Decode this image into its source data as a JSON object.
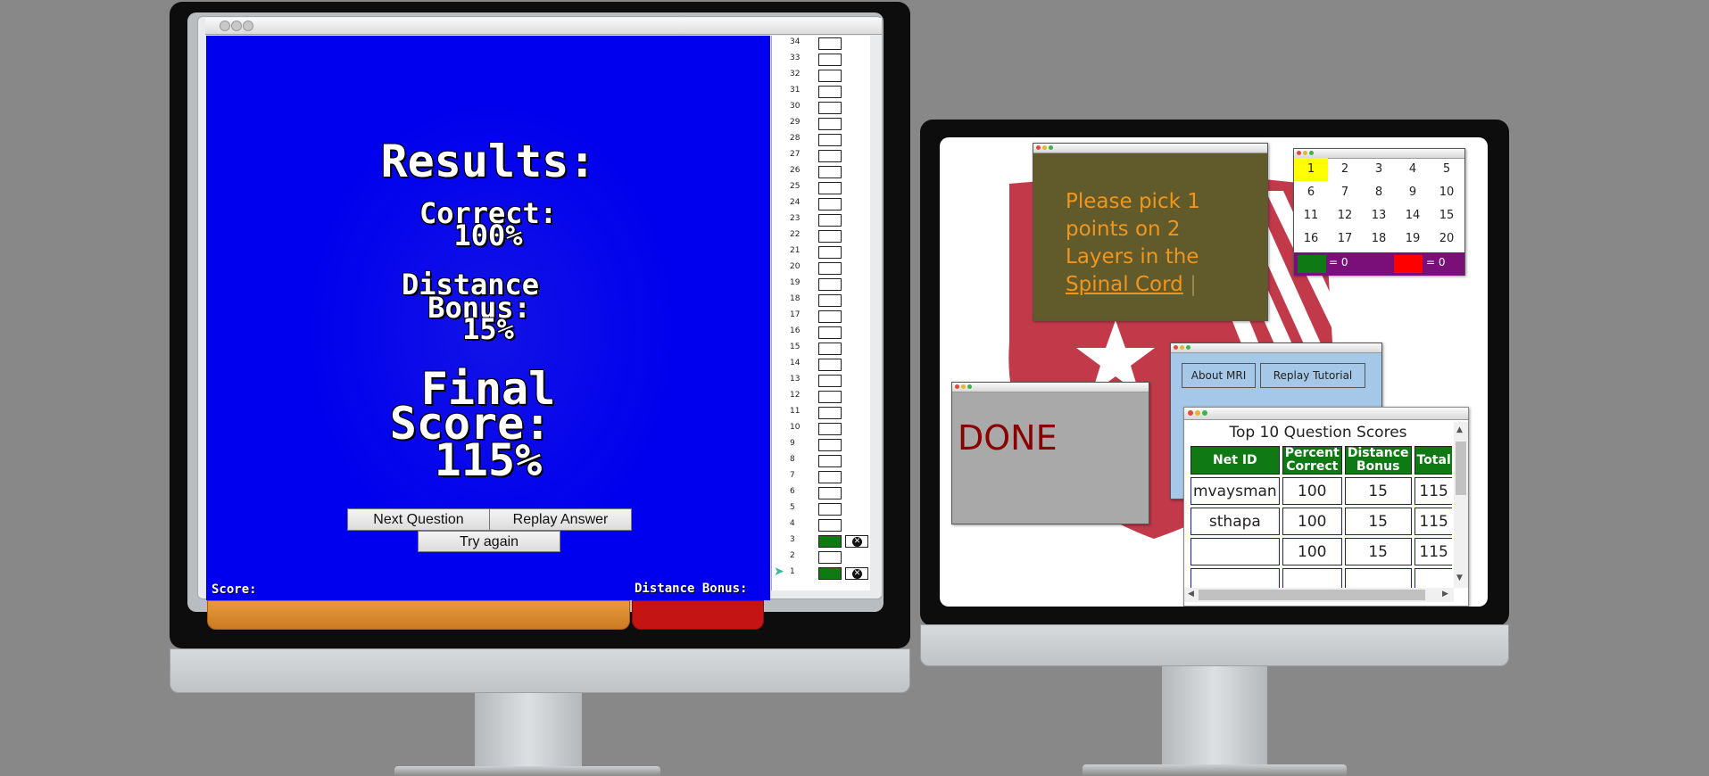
{
  "results": {
    "heading": "Results:",
    "correct_label": "Correct:",
    "correct_value": "100%",
    "distance_label_1": "Distance",
    "distance_label_2": "Bonus:",
    "distance_value": "15%",
    "final_label_1": "Final",
    "final_label_2": "Score:",
    "final_value": "115%"
  },
  "buttons": {
    "next_question": "Next Question",
    "replay_answer": "Replay Answer",
    "try_again": "Try again"
  },
  "hud": {
    "score_label": "Score:",
    "distance_bonus_label": "Distance Bonus:"
  },
  "layers": {
    "numbers": [
      "34",
      "33",
      "32",
      "31",
      "30",
      "29",
      "28",
      "27",
      "26",
      "25",
      "24",
      "23",
      "22",
      "21",
      "20",
      "19",
      "18",
      "17",
      "16",
      "15",
      "14",
      "13",
      "12",
      "11",
      "10",
      "9",
      "8",
      "7",
      "6",
      "5",
      "4",
      "3",
      "2",
      "1"
    ],
    "filled": [
      "3",
      "1"
    ],
    "current_indicator": "1"
  },
  "instruction": {
    "line1": "Please pick 1",
    "line2": "points on 2",
    "line3": "Layers in the",
    "link": "Spinal Cord",
    "cursor": "|"
  },
  "question_grid": {
    "numbers": [
      "1",
      "2",
      "3",
      "4",
      "5",
      "6",
      "7",
      "8",
      "9",
      "10",
      "11",
      "12",
      "13",
      "14",
      "15",
      "16",
      "17",
      "18",
      "19",
      "20"
    ],
    "selected": "1",
    "green_count": "= 0",
    "red_count": "= 0"
  },
  "toolbar": {
    "about": "About MRI",
    "replay_tutorial": "Replay Tutorial"
  },
  "done": {
    "label": "DONE"
  },
  "scoreboard": {
    "title": "Top 10 Question Scores",
    "headers": [
      "Net ID",
      "Percent Correct",
      "Distance Bonus",
      "Total"
    ],
    "rows": [
      [
        "mvaysman",
        "100",
        "15",
        "115"
      ],
      [
        "sthapa",
        "100",
        "15",
        "115"
      ],
      [
        "",
        "100",
        "15",
        "115"
      ]
    ]
  },
  "colors": {
    "game_bg": "#0000ee",
    "instruction_bg": "#615a2a",
    "instruction_text": "#f0961e",
    "header_green": "#0f7a14",
    "selected_yellow": "#ffff00",
    "counter_bar": "#7a0f7a",
    "done_text": "#8b0000"
  }
}
